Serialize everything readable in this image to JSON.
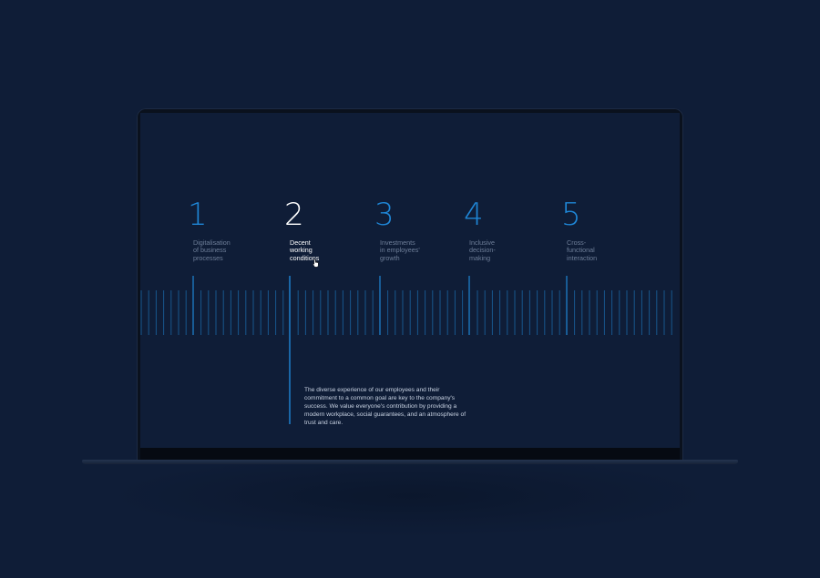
{
  "steps": [
    {
      "number": "1",
      "label": "Digitalisation\nof business\nprocesses",
      "active": false
    },
    {
      "number": "2",
      "label": "Decent\nworking\nconditions",
      "active": true
    },
    {
      "number": "3",
      "label": "Investments\nin employees'\ngrowth",
      "active": false
    },
    {
      "number": "4",
      "label": "Inclusive\ndecision-\nmaking",
      "active": false
    },
    {
      "number": "5",
      "label": "Cross-\nfunctional\ninteraction",
      "active": false
    }
  ],
  "description": "The diverse experience of our employees and their commitment to a common goal are key to the company's success. We value everyone's contribution by providing a modern workplace, social guarantees, and an atmosphere of trust and care.",
  "colors": {
    "background": "#0f1d37",
    "accent": "#1f86d6",
    "active_text": "#ffffff",
    "muted_text": "#6f7f99"
  },
  "icons": {
    "cursor": "hand-pointer-icon"
  }
}
